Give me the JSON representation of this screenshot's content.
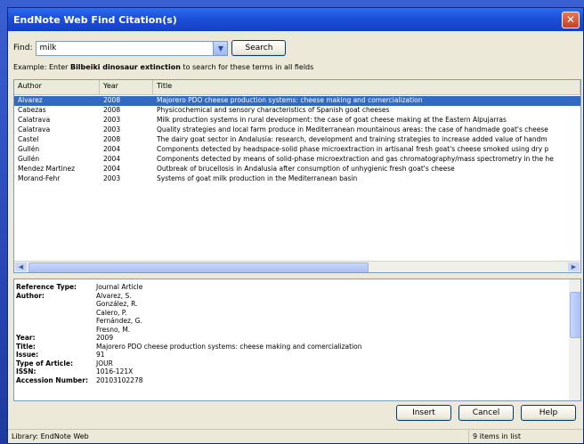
{
  "window": {
    "title": "EndNote Web Find Citation(s)"
  },
  "find": {
    "label": "Find:",
    "value": "milk",
    "search_button": "Search",
    "example_prefix": "Example: Enter ",
    "example_bold": "Bilbeiki dinosaur extinction",
    "example_suffix": " to search for these terms in all fields"
  },
  "results": {
    "columns": [
      "Author",
      "Year",
      "Title"
    ],
    "rows": [
      [
        "Alvarez",
        "2008",
        "Majorero PDO cheese production systems: cheese making and comercialization"
      ],
      [
        "Cabezas",
        "2008",
        "Physicochemical and sensory characteristics of Spanish goat cheeses"
      ],
      [
        "Calatrava",
        "2003",
        "Milk production systems in rural development: the case of goat cheese making at the Eastern Alpujarras"
      ],
      [
        "Calatrava",
        "2003",
        "Quality strategies and local farm produce in Mediterranean mountainous areas: the case of handmade goat's cheese"
      ],
      [
        "Castel",
        "2008",
        "The dairy goat sector in Andalusia: research, development and training strategies to increase added value of handm"
      ],
      [
        "Gullén",
        "2004",
        "Components detected by headspace-solid phase microextraction in artisanal fresh goat's cheese smoked using dry p"
      ],
      [
        "Gullén",
        "2004",
        "Components detected by means of solid-phase microextraction and gas chromatography/mass spectrometry in the he"
      ],
      [
        "Mendez Martinez",
        "2004",
        "Outbreak of brucellosis in Andalusia after consumption of unhygienic fresh goat's cheese"
      ],
      [
        "Morand-Fehr",
        "2003",
        "Systems of goat milk production in the Mediterranean basin"
      ]
    ]
  },
  "details": [
    {
      "label": "Reference Type:",
      "value": "Journal Article"
    },
    {
      "label": "Author:",
      "value": "Alvarez, S."
    },
    {
      "label": "",
      "value": "González, R."
    },
    {
      "label": "",
      "value": "Calero, P."
    },
    {
      "label": "",
      "value": "Fernández, G."
    },
    {
      "label": "",
      "value": "Fresno, M."
    },
    {
      "label": "Year:",
      "value": "2009"
    },
    {
      "label": "Title:",
      "value": "Majorero PDO cheese production systems: cheese making and comercialization"
    },
    {
      "label": "Issue:",
      "value": "91"
    },
    {
      "label": "Type of Article:",
      "value": "JOUR"
    },
    {
      "label": "ISSN:",
      "value": "1016-121X"
    },
    {
      "label": "Accession Number:",
      "value": "20103102278"
    }
  ],
  "buttons": {
    "insert": "Insert",
    "cancel": "Cancel",
    "help": "Help"
  },
  "status": {
    "library": "Library: EndNote Web",
    "count": "9 items in list"
  },
  "colors": {
    "selection": "#316ac5",
    "title_bar": "#1b4fd8",
    "dialog_bg": "#ece9d8"
  },
  "icons": {
    "close": "close-icon",
    "dropdown": "chevron-down-icon"
  }
}
